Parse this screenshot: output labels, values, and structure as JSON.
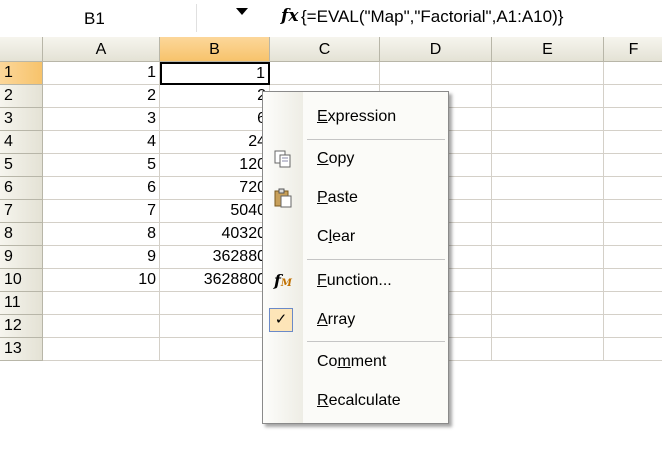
{
  "formula_bar": {
    "name_box": "B1",
    "fx_symbol": "fx",
    "formula": "{=EVAL(\"Map\",\"Factorial\",A1:A10)}"
  },
  "columns": [
    "A",
    "B",
    "C",
    "D",
    "E",
    "F"
  ],
  "rows": [
    "1",
    "2",
    "3",
    "4",
    "5",
    "6",
    "7",
    "8",
    "9",
    "10",
    "11",
    "12",
    "13"
  ],
  "col_a": [
    "1",
    "2",
    "3",
    "4",
    "5",
    "6",
    "7",
    "8",
    "9",
    "10",
    "",
    "",
    ""
  ],
  "col_b": [
    "1",
    "2",
    "6",
    "24",
    "120",
    "720",
    "5040",
    "40320",
    "362880",
    "3628800",
    "",
    "",
    ""
  ],
  "active_cell": "B1",
  "context_menu": {
    "items": [
      {
        "label": "Expression",
        "accel": "E",
        "icon": ""
      },
      {
        "label": "Copy",
        "accel": "C",
        "icon": "copy-icon"
      },
      {
        "label": "Paste",
        "accel": "P",
        "icon": "paste-icon"
      },
      {
        "label": "Clear",
        "accel": "l",
        "icon": ""
      },
      {
        "label": "Function...",
        "accel": "F",
        "icon": "function-icon"
      },
      {
        "label": "Array",
        "accel": "A",
        "icon": "checkmark-icon",
        "checked": true
      },
      {
        "label": "Comment",
        "accel": "m",
        "icon": ""
      },
      {
        "label": "Recalculate",
        "accel": "R",
        "icon": ""
      }
    ]
  },
  "colors": {
    "selected_header": "#f7c36b",
    "menu_check_bg": "#fde5b8"
  }
}
